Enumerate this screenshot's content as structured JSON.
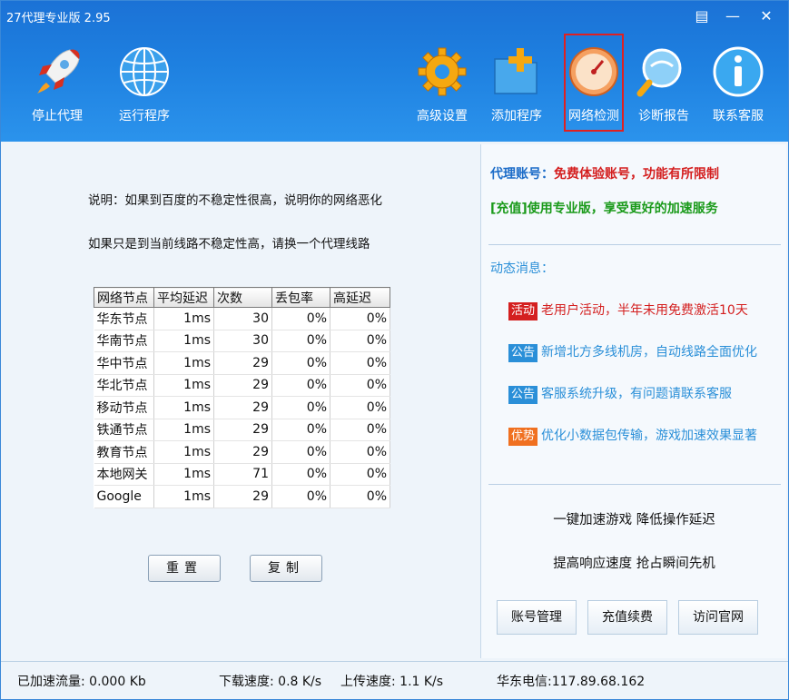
{
  "window": {
    "title": "27代理专业版 2.95"
  },
  "controls": {
    "menu": "▤",
    "minimize": "—",
    "close": "✕"
  },
  "toolbar": {
    "stop_proxy": "停止代理",
    "run_program": "运行程序",
    "advanced_settings": "高级设置",
    "add_program": "添加程序",
    "network_check": "网络检测",
    "diagnosis_report": "诊断报告",
    "contact_support": "联系客服"
  },
  "left": {
    "desc1": "说明：如果到百度的不稳定性很高，说明你的网络恶化",
    "desc2": "如果只是到当前线路不稳定性高，请换一个代理线路",
    "table": {
      "headers": [
        "网络节点",
        "平均延迟",
        "次数",
        "丢包率",
        "高延迟"
      ],
      "rows": [
        [
          "华东节点",
          "1ms",
          "30",
          "0%",
          "0%"
        ],
        [
          "华南节点",
          "1ms",
          "30",
          "0%",
          "0%"
        ],
        [
          "华中节点",
          "1ms",
          "29",
          "0%",
          "0%"
        ],
        [
          "华北节点",
          "1ms",
          "29",
          "0%",
          "0%"
        ],
        [
          "移动节点",
          "1ms",
          "29",
          "0%",
          "0%"
        ],
        [
          "铁通节点",
          "1ms",
          "29",
          "0%",
          "0%"
        ],
        [
          "教育节点",
          "1ms",
          "29",
          "0%",
          "0%"
        ],
        [
          "本地网关",
          "1ms",
          "71",
          "0%",
          "0%"
        ],
        [
          "Google",
          "1ms",
          "29",
          "0%",
          "0%"
        ]
      ]
    },
    "reset_label": "重置",
    "copy_label": "复制"
  },
  "right": {
    "account_label": "代理账号：",
    "account_value": "免费体验账号，功能有所限制",
    "recharge_line": "[充值]使用专业版，享受更好的加速服务",
    "news_title": "动态消息：",
    "news": [
      {
        "tag": "活动",
        "text": "老用户活动，半年未用免费激活10天",
        "tag_color": "#d42020",
        "text_color": "#d42020"
      },
      {
        "tag": "公告",
        "text": "新增北方多线机房，自动线路全面优化",
        "tag_color": "#2a8fd8",
        "text_color": "#2a8fd8"
      },
      {
        "tag": "公告",
        "text": "客服系统升级，有问题请联系客服",
        "tag_color": "#2a8fd8",
        "text_color": "#2a8fd8"
      },
      {
        "tag": "优势",
        "text": "优化小数据包传输，游戏加速效果显著",
        "tag_color": "#f07020",
        "text_color": "#2a8fd8"
      }
    ],
    "promo1": "一键加速游戏  降低操作延迟",
    "promo2": "提高响应速度  抢占瞬间先机",
    "btn_account": "账号管理",
    "btn_recharge": "充值续费",
    "btn_website": "访问官网"
  },
  "status": {
    "traffic": "已加速流量: 0.000 Kb",
    "download": "下载速度: 0.8 K/s",
    "upload": "上传速度: 1.1 K/s",
    "line": "华东电信:117.89.68.162"
  },
  "colors": {
    "accent": "#1e80e0",
    "red": "#d42020",
    "green": "#1a9a1a",
    "blue": "#2a8fd8",
    "orange": "#f07020"
  }
}
